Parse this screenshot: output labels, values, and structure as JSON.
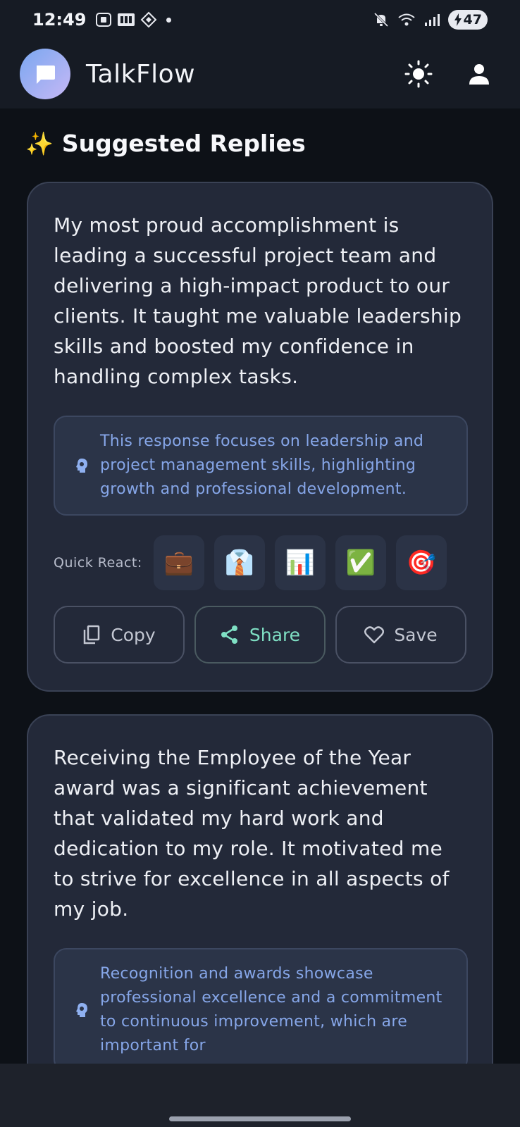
{
  "status_bar": {
    "time": "12:49",
    "battery": "47",
    "icons": [
      "screenshot-icon",
      "photos-icon",
      "location-icon",
      "mute-icon",
      "wifi-icon",
      "signal-icon",
      "battery-charging-icon"
    ]
  },
  "header": {
    "title": "TalkFlow",
    "logo_icon": "chat-bubble-icon",
    "actions": [
      "theme-toggle-sun-icon",
      "profile-icon"
    ]
  },
  "section": {
    "sparkle": "✨",
    "title": "Suggested Replies"
  },
  "cards": [
    {
      "reply": "My most proud accomplishment is leading a successful project team and delivering a high-impact product to our clients. It taught me valuable leadership skills and boosted my confidence in handling complex tasks.",
      "insight": "This response focuses on leadership and project management skills, highlighting growth and professional development.",
      "quick_react_label": "Quick React:",
      "reactions": [
        "💼",
        "👔",
        "📊",
        "✅",
        "🎯"
      ],
      "actions": {
        "copy": "Copy",
        "share": "Share",
        "save": "Save"
      }
    },
    {
      "reply": "Receiving the Employee of the Year award was a significant achievement that validated my hard work and dedication to my role. It motivated me to strive for excellence in all aspects of my job.",
      "insight": "Recognition and awards showcase professional excellence and a commitment to continuous improvement, which are important for"
    }
  ],
  "colors": {
    "background": "#0d1117",
    "card": "#232939",
    "insight_text": "#86a6e8",
    "share_accent": "#7fe0c4"
  }
}
